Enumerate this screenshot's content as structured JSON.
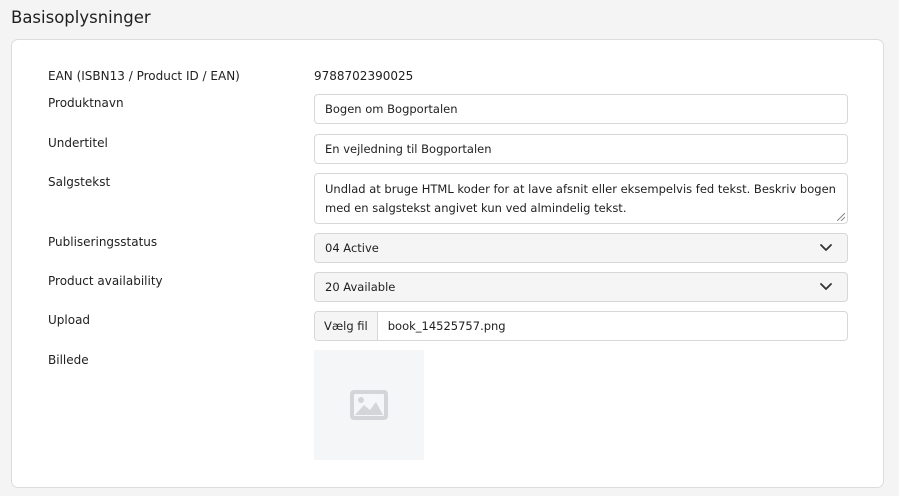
{
  "page": {
    "title": "Basisoplysninger"
  },
  "form": {
    "ean": {
      "label": "EAN (ISBN13 / Product ID / EAN)",
      "value": "9788702390025"
    },
    "product_name": {
      "label": "Produktnavn",
      "value": "Bogen om Bogportalen"
    },
    "subtitle": {
      "label": "Undertitel",
      "value": "En vejledning til Bogportalen"
    },
    "sales_text": {
      "label": "Salgstekst",
      "value": "Undlad at bruge HTML koder for at lave afsnit eller eksempelvis fed tekst. Beskriv bogen med en salgstekst angivet kun ved almindelig tekst."
    },
    "publishing_status": {
      "label": "Publiseringsstatus",
      "value": "04 Active"
    },
    "availability": {
      "label": "Product availability",
      "value": "20 Available"
    },
    "upload": {
      "label": "Upload",
      "button_label": "Vælg fil",
      "file_name": "book_14525757.png"
    },
    "image": {
      "label": "Billede",
      "icon": "image-placeholder-icon"
    }
  },
  "colors": {
    "background": "#f4f4f5",
    "card": "#ffffff",
    "border": "#d7d7d7",
    "select_bg": "#f5f5f5",
    "placeholder_icon": "#d3d5d8"
  }
}
